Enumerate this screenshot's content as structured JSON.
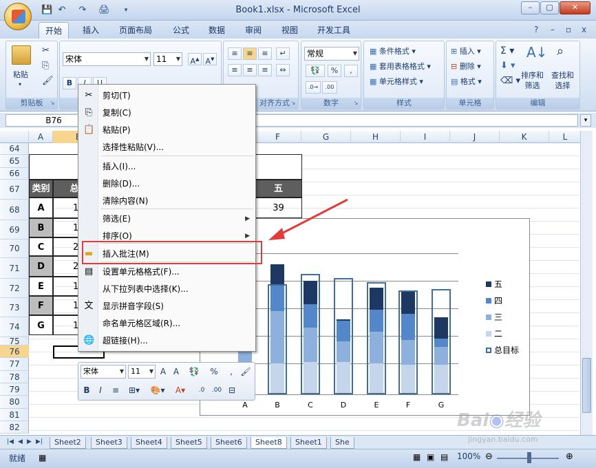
{
  "window": {
    "title": "Book1.xlsx - Microsoft Excel"
  },
  "ribbon": {
    "tabs": [
      "开始",
      "插入",
      "页面布局",
      "公式",
      "数据",
      "审阅",
      "视图",
      "开发工具"
    ],
    "groups": {
      "clipboard": {
        "label": "剪贴板",
        "paste": "粘贴"
      },
      "font": {
        "label": "字体",
        "font_name": "宋体",
        "font_size": "11"
      },
      "alignment": {
        "label": "对齐方式"
      },
      "number": {
        "label": "数字",
        "format": "常规"
      },
      "styles": {
        "label": "样式",
        "conditional": "条件格式",
        "table_format": "套用表格格式",
        "cell_styles": "单元格样式"
      },
      "cells": {
        "label": "单元格",
        "insert": "插入",
        "delete": "删除",
        "format": "格式"
      },
      "editing": {
        "label": "编辑",
        "sort_filter_1": "排序和",
        "sort_filter_2": "筛选",
        "find_select_1": "查找和",
        "find_select_2": "选择"
      }
    }
  },
  "formula_bar": {
    "name_box": "B76"
  },
  "grid": {
    "columns": [
      "A",
      "B",
      "C",
      "D",
      "E",
      "F",
      "G",
      "H",
      "I",
      "J",
      "K",
      "L"
    ],
    "rows": [
      "64",
      "65",
      "66",
      "67",
      "68",
      "69",
      "70",
      "71",
      "72",
      "73",
      "74",
      "75",
      "76",
      "77",
      "78",
      "79",
      "80",
      "81",
      "82"
    ],
    "active_row": "76"
  },
  "table": {
    "header": [
      "类别",
      "总目",
      "五"
    ],
    "categories": [
      "A",
      "B",
      "C",
      "D",
      "E",
      "F",
      "G"
    ],
    "col_b": [
      "18",
      "19",
      "2",
      "20",
      "19",
      "18",
      "18"
    ],
    "f68": "39"
  },
  "context_menu": {
    "items": [
      {
        "label": "剪切(T)",
        "icon": "scissors-icon"
      },
      {
        "label": "复制(C)",
        "icon": "copy-icon"
      },
      {
        "label": "粘贴(P)",
        "icon": "paste-icon"
      },
      {
        "label": "选择性粘贴(V)...",
        "icon": ""
      },
      {
        "label": "插入(I)...",
        "icon": ""
      },
      {
        "label": "删除(D)...",
        "icon": ""
      },
      {
        "label": "清除内容(N)",
        "icon": ""
      },
      {
        "label": "筛选(E)",
        "icon": "",
        "submenu": true
      },
      {
        "label": "排序(O)",
        "icon": "",
        "submenu": true
      },
      {
        "label": "插入批注(M)",
        "icon": "comment-icon"
      },
      {
        "label": "设置单元格格式(F)...",
        "icon": "format-cells-icon"
      },
      {
        "label": "从下拉列表中选择(K)...",
        "icon": ""
      },
      {
        "label": "显示拼音字段(S)",
        "icon": "phonetic-icon"
      },
      {
        "label": "命名单元格区域(R)...",
        "icon": ""
      },
      {
        "label": "超链接(H)...",
        "icon": "hyperlink-icon"
      }
    ]
  },
  "mini_toolbar": {
    "font_name": "宋体",
    "font_size": "11"
  },
  "chart_data": {
    "type": "bar",
    "stacked": true,
    "categories": [
      "A",
      "B",
      "C",
      "D",
      "E",
      "F",
      "G"
    ],
    "series": [
      {
        "name": "二",
        "color": "#c5d6ec"
      },
      {
        "name": "三",
        "color": "#8db0dd"
      },
      {
        "name": "四",
        "color": "#5487c9"
      },
      {
        "name": "五",
        "color": "#1e3864"
      },
      {
        "name": "总目标",
        "color": "#3f6f97"
      }
    ],
    "legend_position": "right",
    "gridlines": true
  },
  "sheets": {
    "tabs": [
      "Sheet2",
      "Sheet3",
      "Sheet4",
      "Sheet5",
      "Sheet6",
      "Sheet8",
      "Sheet1",
      "She"
    ],
    "active": "Sheet8"
  },
  "status": {
    "ready": "就绪",
    "zoom": "100%"
  },
  "watermark": "Baidu经验 jingyan.baidu.com"
}
